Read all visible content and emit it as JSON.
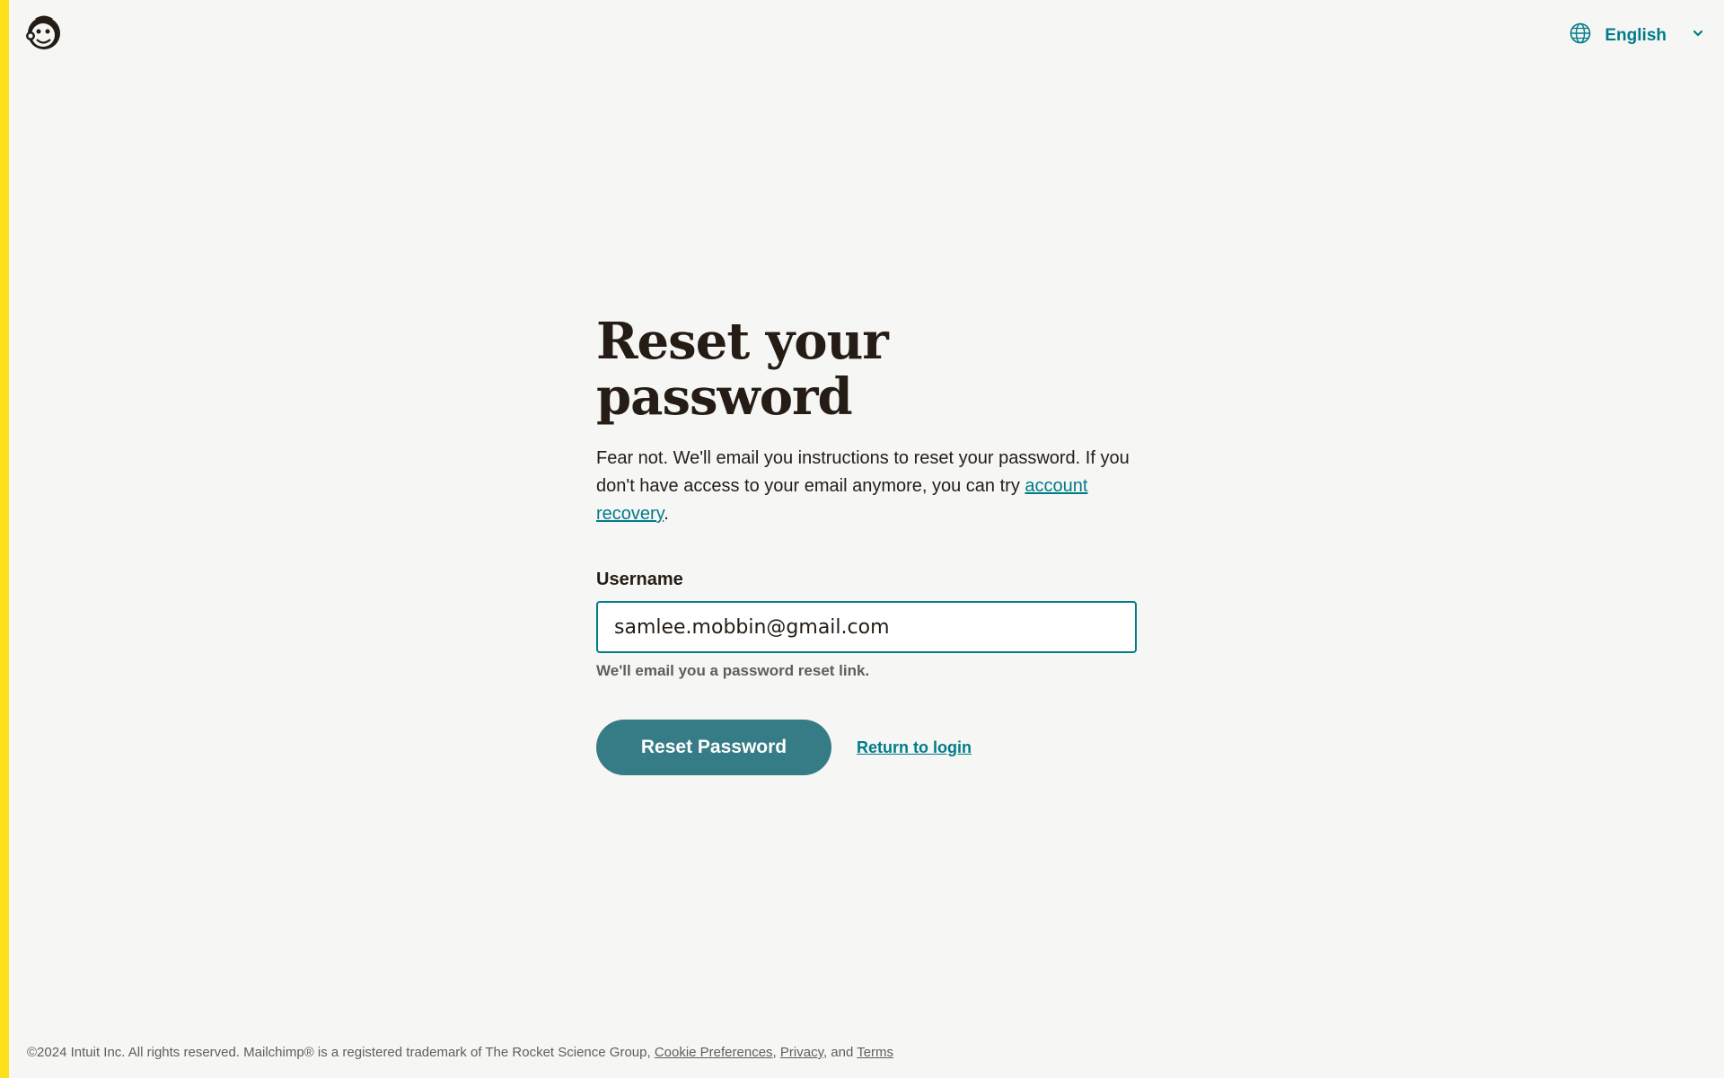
{
  "header": {
    "logo_alt": "Mailchimp",
    "language": "English"
  },
  "main": {
    "title": "Reset your password",
    "intro": "Fear not. We'll email you instructions to reset your password. If you don't have access to your email anymore, you can try ",
    "recovery_link": "account recovery",
    "intro_end": ".",
    "username_label": "Username",
    "username_value": "samlee.mobbin@gmail.com",
    "hint": "We'll email you a password reset link.",
    "reset_button": "Reset Password",
    "return_link": "Return to login"
  },
  "footer": {
    "text": "©2024 Intuit Inc. All rights reserved. Mailchimp® is a registered trademark of The Rocket Science Group, ",
    "cookie": "Cookie Preferences",
    "sep1": ", ",
    "privacy": "Privacy",
    "sep2": ", and ",
    "terms": "Terms"
  },
  "colors": {
    "accent": "#ffe01b",
    "brand": "#007c89",
    "button": "#367c87",
    "background": "#f6f6f4"
  },
  "icons": [
    "mailchimp-logo-icon",
    "globe-icon",
    "chevron-down-icon"
  ]
}
